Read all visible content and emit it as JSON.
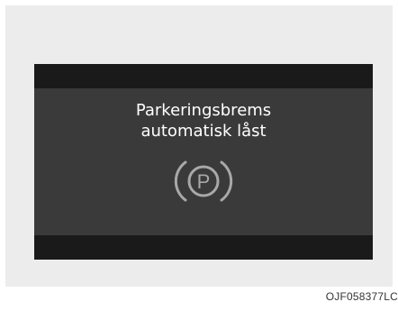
{
  "display": {
    "line1": "Parkeringsbrems",
    "line2": "automatisk låst",
    "icon": "parking-brake-icon",
    "icon_letter": "P"
  },
  "caption": "OJF058377LC",
  "colors": {
    "screen": "#3a3a3a",
    "bars": "#1a1a1a",
    "text": "#ffffff",
    "icon": "#a8a8a8",
    "surround": "#ececec"
  }
}
